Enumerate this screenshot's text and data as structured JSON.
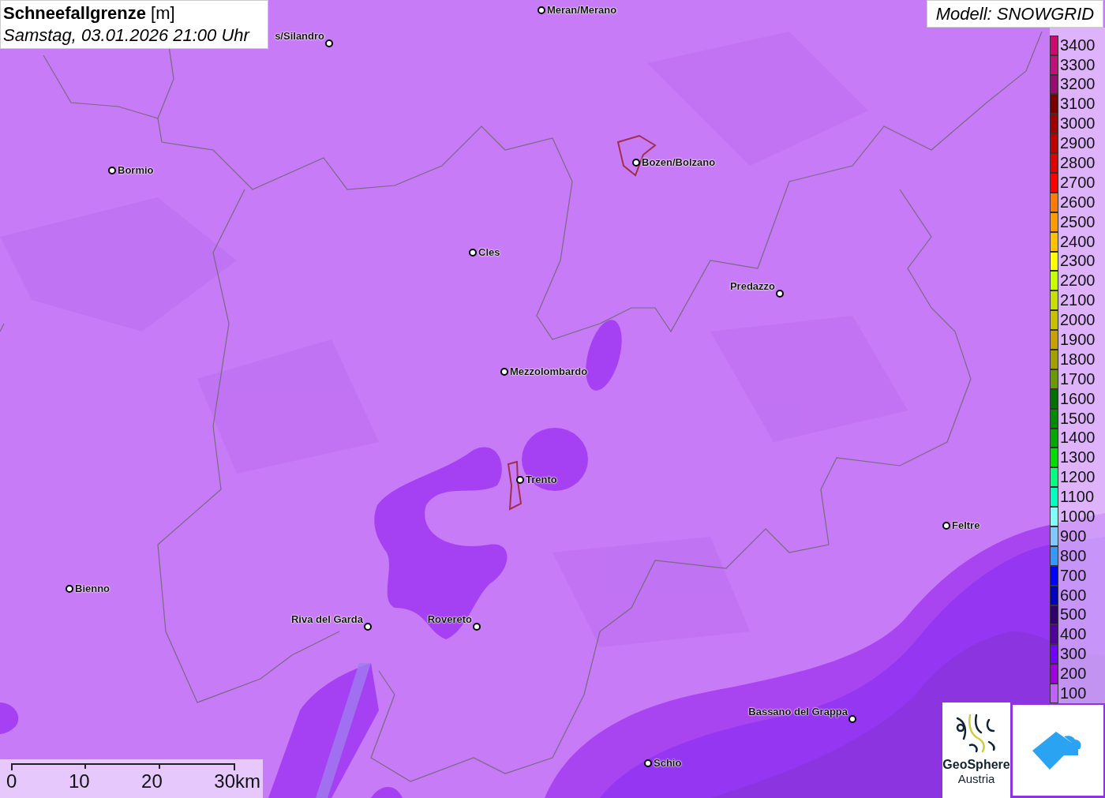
{
  "title": {
    "text": "Schneefallgrenze",
    "unit": "[m]",
    "datetime": "Samstag, 03.01.2026 21:00 Uhr"
  },
  "model": "Modell: SNOWGRID",
  "places": [
    {
      "name": "Meran/Merano",
      "kind": "city"
    },
    {
      "name": "s/Silandro",
      "kind": "city"
    },
    {
      "name": "Bormio",
      "kind": "city"
    },
    {
      "name": "Bozen/Bolzano",
      "kind": "city"
    },
    {
      "name": "Cles",
      "kind": "city"
    },
    {
      "name": "Predazzo",
      "kind": "city"
    },
    {
      "name": "Mezzolombardo",
      "kind": "city"
    },
    {
      "name": "Trento",
      "kind": "city"
    },
    {
      "name": "Feltre",
      "kind": "city"
    },
    {
      "name": "Bienno",
      "kind": "city"
    },
    {
      "name": "Riva del Garda",
      "kind": "city"
    },
    {
      "name": "Rovereto",
      "kind": "city"
    },
    {
      "name": "Bassano del Grappa",
      "kind": "city"
    },
    {
      "name": "Schio",
      "kind": "city"
    }
  ],
  "legend": [
    {
      "label": "3400",
      "color": "#cc0a70"
    },
    {
      "label": "3300",
      "color": "#c0107a"
    },
    {
      "label": "3200",
      "color": "#9a0a70"
    },
    {
      "label": "3100",
      "color": "#7a0000"
    },
    {
      "label": "3000",
      "color": "#a00000"
    },
    {
      "label": "2900",
      "color": "#c00000"
    },
    {
      "label": "2800",
      "color": "#e00000"
    },
    {
      "label": "2700",
      "color": "#ff0000"
    },
    {
      "label": "2600",
      "color": "#ff7a00"
    },
    {
      "label": "2500",
      "color": "#ff9a00"
    },
    {
      "label": "2400",
      "color": "#ffc000"
    },
    {
      "label": "2300",
      "color": "#ffff00"
    },
    {
      "label": "2200",
      "color": "#c8ff00"
    },
    {
      "label": "2100",
      "color": "#c8e000"
    },
    {
      "label": "2000",
      "color": "#c8c000"
    },
    {
      "label": "1900",
      "color": "#c8a000"
    },
    {
      "label": "1800",
      "color": "#a0a000"
    },
    {
      "label": "1700",
      "color": "#6a9a00"
    },
    {
      "label": "1600",
      "color": "#007000"
    },
    {
      "label": "1500",
      "color": "#008a00"
    },
    {
      "label": "1400",
      "color": "#00aa00"
    },
    {
      "label": "1300",
      "color": "#00dd00"
    },
    {
      "label": "1200",
      "color": "#00ff80"
    },
    {
      "label": "1100",
      "color": "#00ffc0"
    },
    {
      "label": "1000",
      "color": "#80ffff"
    },
    {
      "label": "900",
      "color": "#80c8ff"
    },
    {
      "label": "800",
      "color": "#3399ff"
    },
    {
      "label": "700",
      "color": "#0000ff"
    },
    {
      "label": "600",
      "color": "#0000c0"
    },
    {
      "label": "500",
      "color": "#300070"
    },
    {
      "label": "400",
      "color": "#5000a0"
    },
    {
      "label": "300",
      "color": "#7000ff"
    },
    {
      "label": "200",
      "color": "#a000e0"
    },
    {
      "label": "100",
      "color": "#c060ff"
    }
  ],
  "scale": {
    "ticks": [
      "0",
      "10",
      "20",
      "30km"
    ]
  },
  "logo": {
    "line1": "GeoSphere",
    "line2": "Austria"
  }
}
